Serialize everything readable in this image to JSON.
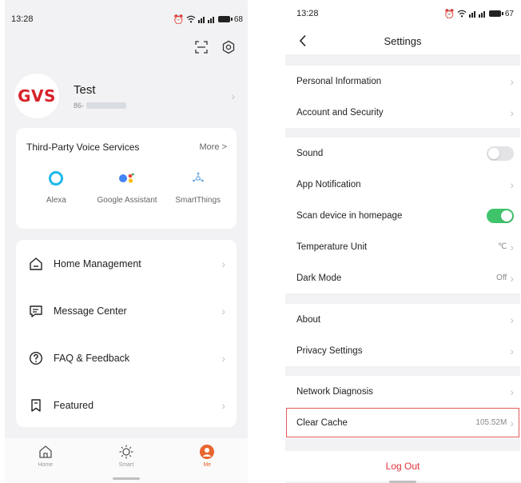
{
  "left": {
    "status": {
      "time": "13:28",
      "battery": "68"
    },
    "profile": {
      "logo_text": "GVS",
      "name": "Test",
      "phone_prefix": "86-"
    },
    "voice_services": {
      "title": "Third-Party Voice Services",
      "more": "More >",
      "items": [
        {
          "label": "Alexa",
          "icon": "alexa-icon"
        },
        {
          "label": "Google Assistant",
          "icon": "google-assistant-icon"
        },
        {
          "label": "SmartThings",
          "icon": "smartthings-icon"
        }
      ]
    },
    "menu": [
      {
        "label": "Home Management",
        "icon": "house-icon"
      },
      {
        "label": "Message Center",
        "icon": "message-icon"
      },
      {
        "label": "FAQ & Feedback",
        "icon": "question-icon"
      },
      {
        "label": "Featured",
        "icon": "bookmark-icon"
      }
    ],
    "tabs": [
      {
        "label": "Home",
        "icon": "home-tab-icon"
      },
      {
        "label": "Smart",
        "icon": "sun-icon"
      },
      {
        "label": "Me",
        "icon": "person-icon"
      }
    ],
    "accent_color": "#e8652e"
  },
  "right": {
    "status": {
      "time": "13:28",
      "battery": "67"
    },
    "title": "Settings",
    "groups": [
      [
        {
          "label": "Personal Information"
        },
        {
          "label": "Account and Security"
        }
      ],
      [
        {
          "label": "Sound",
          "toggle": "off"
        },
        {
          "label": "App Notification"
        },
        {
          "label": "Scan device in homepage",
          "toggle": "on"
        },
        {
          "label": "Temperature Unit",
          "value": "℃"
        },
        {
          "label": "Dark Mode",
          "value": "Off"
        }
      ],
      [
        {
          "label": "About"
        },
        {
          "label": "Privacy Settings"
        }
      ],
      [
        {
          "label": "Network Diagnosis"
        },
        {
          "label": "Clear Cache",
          "value": "105.52M",
          "highlighted": true
        }
      ]
    ],
    "logout": "Log Out",
    "toggle_on_color": "#3fc46b",
    "logout_color": "#e0323a",
    "highlight_color": "#e55a5a"
  }
}
